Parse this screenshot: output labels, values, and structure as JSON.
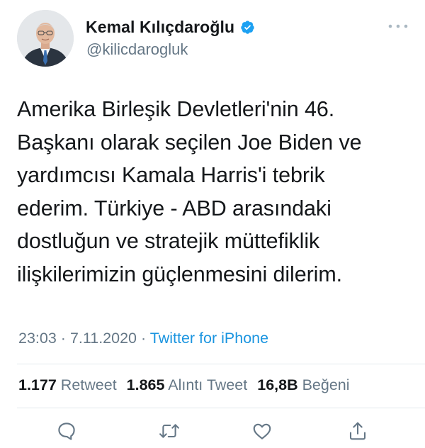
{
  "user": {
    "display_name": "Kemal Kılıçdaroğlu",
    "handle": "@kilicdarogluk"
  },
  "tweet": {
    "lines": [
      "Amerika Birleşik Devletleri'nin 46.",
      "Başkanı olarak seçilen Joe Biden ve",
      "yardımcısı Kamala Harris'i tebrik",
      "ederim. Türkiye - ABD arasındaki",
      "dostluğun ve stratejik müttefiklik",
      "ilişkilerimizin güçlenmesini dilerim."
    ],
    "time": "23:03",
    "date": "7.11.2020",
    "separator": "·",
    "source": "Twitter for iPhone"
  },
  "stats": {
    "retweets_count": "1.177",
    "retweets_label": "Retweet",
    "quotes_count": "1.865",
    "quotes_label": "Alıntı Tweet",
    "likes_count": "16,8B",
    "likes_label": "Beğeni"
  },
  "icons": {
    "verified": "verified-badge-icon",
    "more": "more-options-icon",
    "reply": "reply-icon",
    "retweet": "retweet-icon",
    "like": "heart-icon",
    "share": "share-icon"
  },
  "colors": {
    "accent": "#1da1f2",
    "link": "#1b95e0",
    "text": "#14171a",
    "secondary": "#657786",
    "divider": "#e1e8ed",
    "icon": "#657786"
  }
}
